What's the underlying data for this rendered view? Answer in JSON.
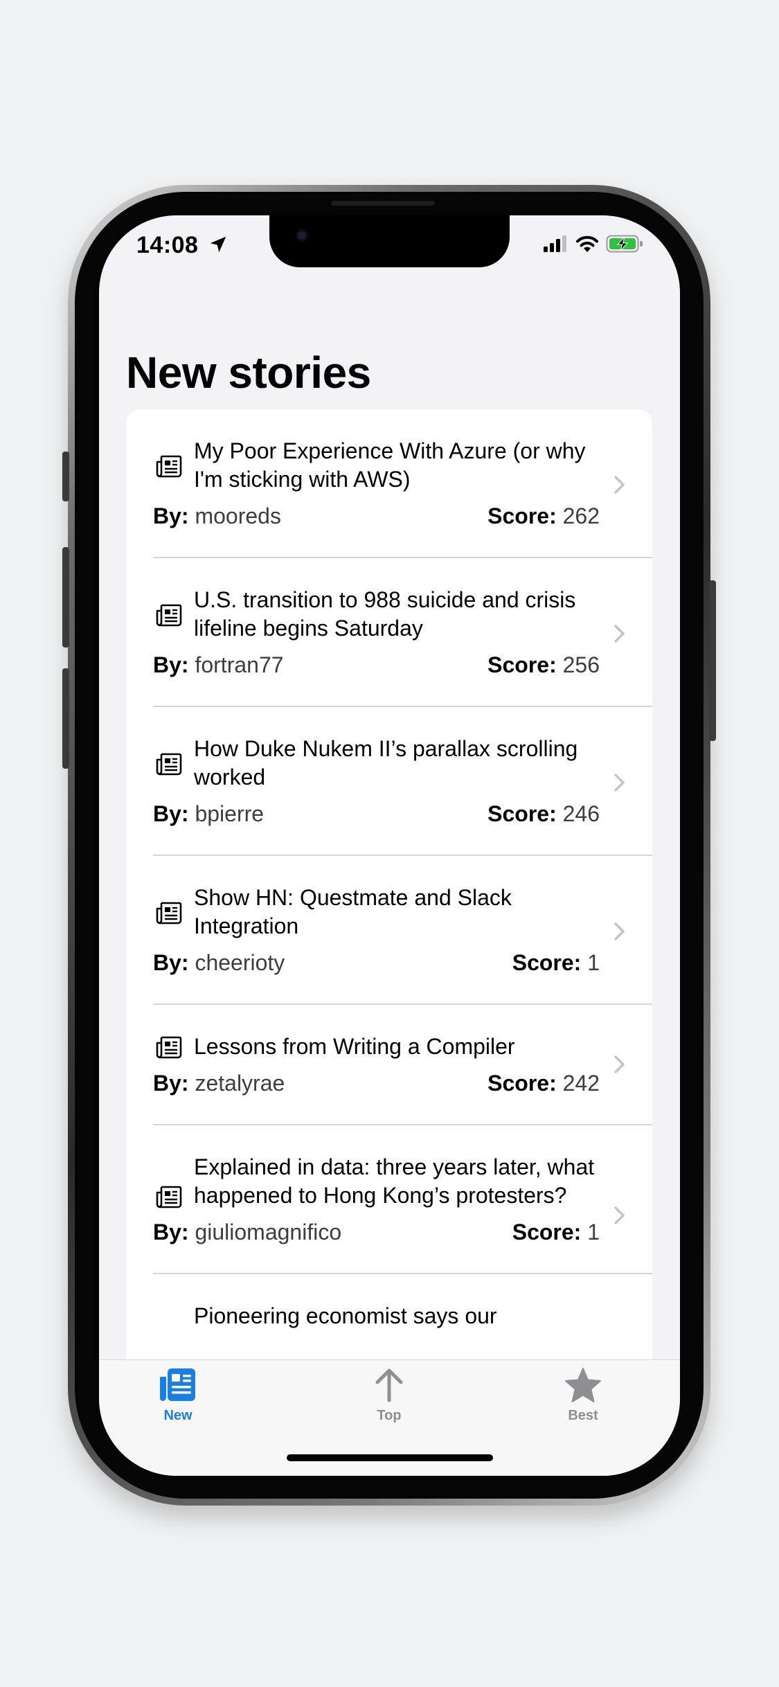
{
  "status_bar": {
    "time": "14:08"
  },
  "page": {
    "title": "New stories"
  },
  "labels": {
    "by": "By:",
    "score": "Score:"
  },
  "stories": [
    {
      "title": "My Poor Experience With Azure (or why I'm sticking with AWS)",
      "author": "mooreds",
      "score": "262"
    },
    {
      "title": "U.S. transition to 988 suicide and crisis lifeline begins Saturday",
      "author": "fortran77",
      "score": "256"
    },
    {
      "title": "How Duke Nukem II’s parallax scrolling worked",
      "author": "bpierre",
      "score": "246"
    },
    {
      "title": "Show HN: Questmate and Slack Integration",
      "author": "cheerioty",
      "score": "1"
    },
    {
      "title": "Lessons from Writing a Compiler",
      "author": "zetalyrae",
      "score": "242"
    },
    {
      "title": "Explained in data: three years later, what happened to Hong Kong’s protesters?",
      "author": "giuliomagnifico",
      "score": "1"
    },
    {
      "title": "Pioneering economist says our",
      "author": "",
      "score": ""
    }
  ],
  "tabs": [
    {
      "label": "New",
      "icon": "newspaper-icon",
      "selected": true
    },
    {
      "label": "Top",
      "icon": "arrow-up-icon",
      "selected": false
    },
    {
      "label": "Best",
      "icon": "star-icon",
      "selected": false
    }
  ],
  "colors": {
    "accent": "#1a7fe3",
    "tab_inactive": "#8e8e93",
    "battery": "#30c23f"
  }
}
